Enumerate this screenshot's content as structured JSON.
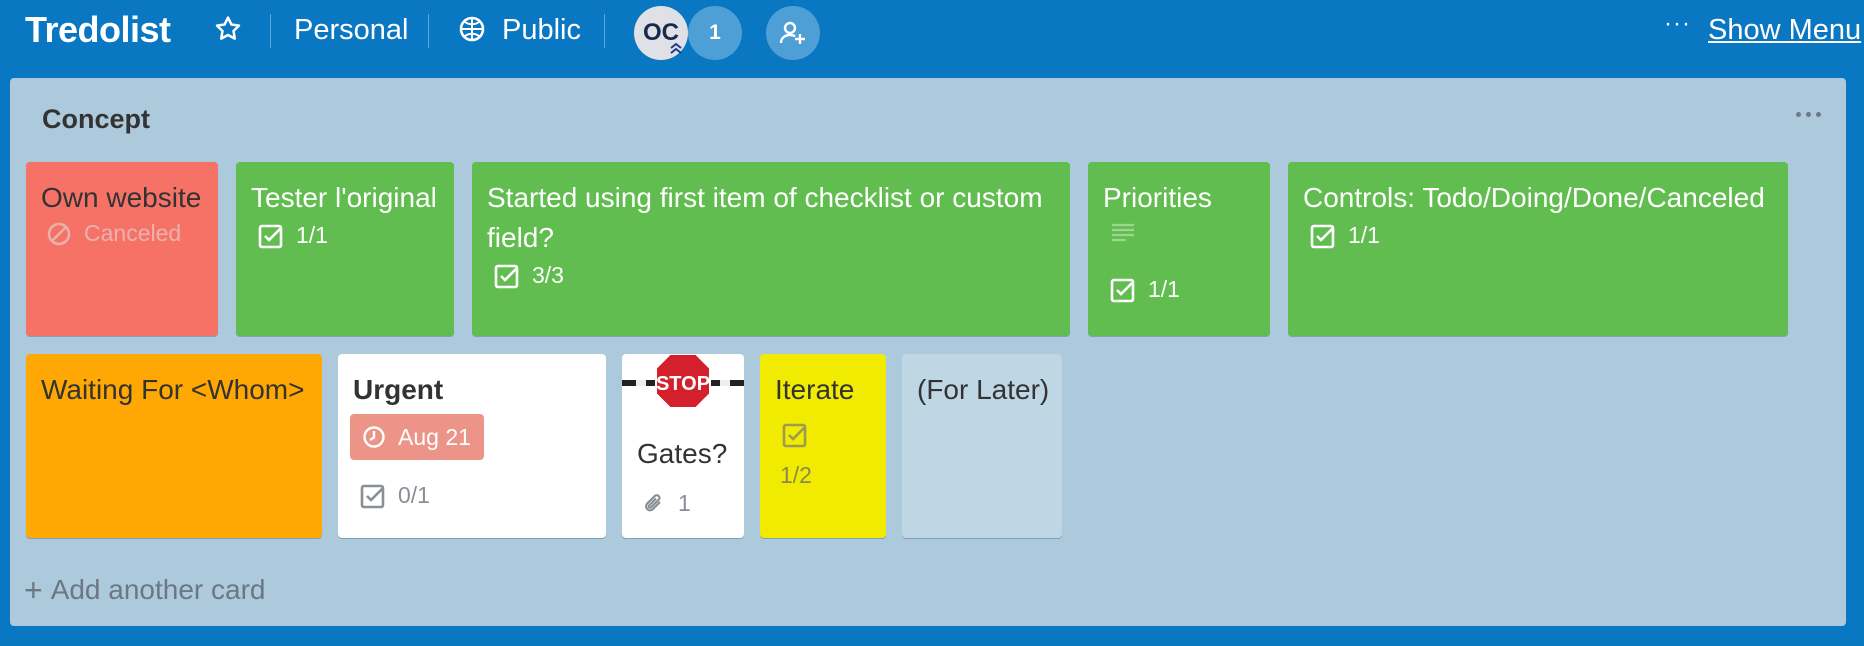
{
  "header": {
    "board_title": "Tredolist",
    "star_icon": "star-icon",
    "team_label": "Personal",
    "visibility_label": "Public",
    "member_initials": "OC",
    "member_count": "1",
    "more_icon": "···",
    "show_menu_label": "Show Menu"
  },
  "list": {
    "title": "Concept",
    "add_card_label": "Add another card",
    "cards": [
      {
        "title": "Own website",
        "color": "#f67266",
        "badge": "Canceled",
        "badge_icon": "canceled-icon"
      },
      {
        "title": "Tester l'original",
        "color": "#61bd4f",
        "checklist": "1/1"
      },
      {
        "title": "Started using first item of checklist or custom field?",
        "color": "#61bd4f",
        "checklist": "3/3"
      },
      {
        "title": "Priorities",
        "color": "#61bd4f",
        "checklist": "1/1",
        "has_description": true
      },
      {
        "title": "Controls: Todo/Doing/Done/Canceled",
        "color": "#61bd4f",
        "checklist": "1/1"
      },
      {
        "title": "Waiting For <Whom>",
        "color": "#ffa703"
      },
      {
        "title": "Urgent",
        "color": "#ffffff",
        "due": "Aug 21",
        "checklist": "0/1"
      },
      {
        "title": "Gates?",
        "color": "#ffffff",
        "cover_text": "STOP",
        "attachments": "1"
      },
      {
        "title": "Iterate",
        "color": "#f0eb00",
        "checklist": "1/2"
      },
      {
        "title": "(For Later)",
        "color": "#bfd6e5"
      }
    ]
  }
}
